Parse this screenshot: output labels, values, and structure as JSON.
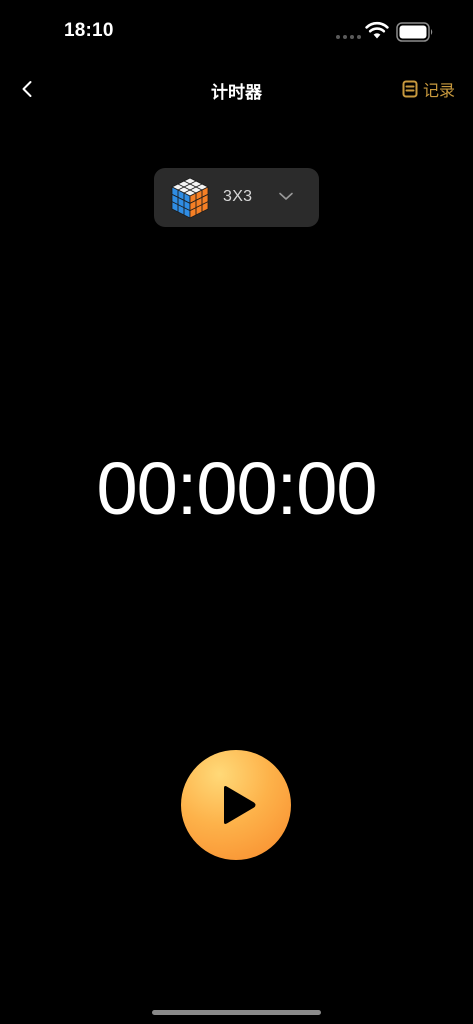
{
  "status_bar": {
    "time": "18:10"
  },
  "nav": {
    "title": "计时器",
    "records_label": "记录",
    "records_icon": "document-list-icon",
    "back_icon": "chevron-left-icon"
  },
  "selector": {
    "cube_type": "3X3",
    "cube_icon": "rubiks-cube-icon",
    "dropdown_icon": "chevron-down-icon"
  },
  "timer": {
    "display": "00:00:00"
  },
  "controls": {
    "play_icon": "play-icon"
  },
  "colors": {
    "background": "#000000",
    "accent": "#c99a3e",
    "play_gradient_start": "#ffd978",
    "play_gradient_end": "#f88a2c",
    "selector_bg": "#2b2b2b"
  }
}
